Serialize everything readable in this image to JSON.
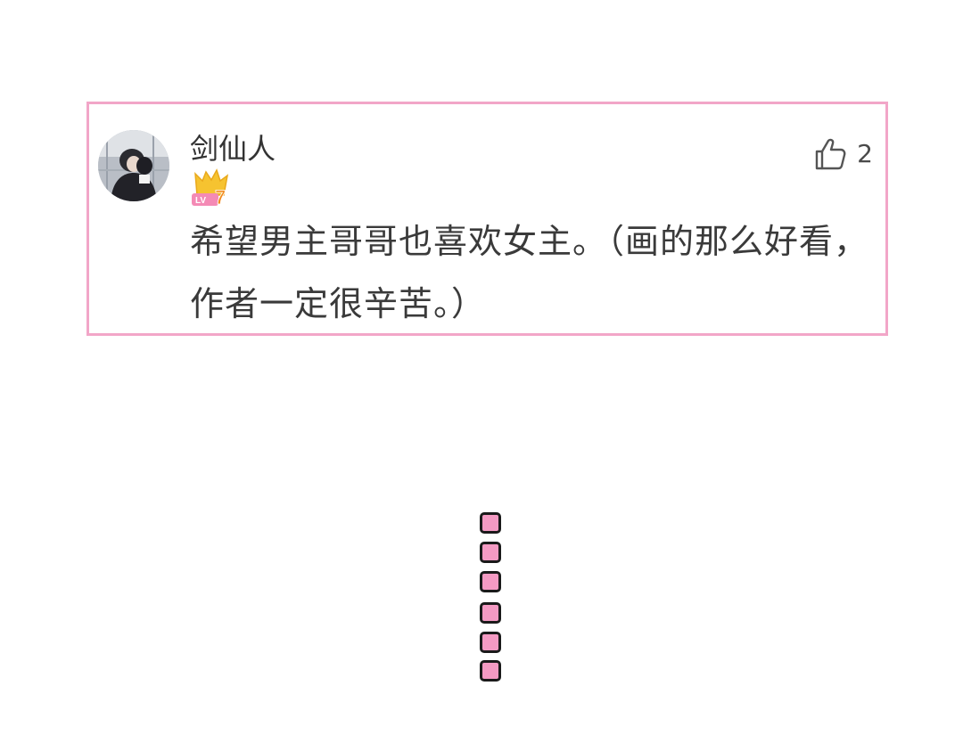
{
  "comment": {
    "username": "剑仙人",
    "level_badge": "LV7",
    "likes": "2",
    "text": "希望男主哥哥也喜欢女主。（画的那么好看，作者一定很辛苦。）"
  },
  "icons": {
    "like": "thumbs-up-icon",
    "avatar": "user-avatar",
    "divider": "vertical-dot-divider"
  },
  "colors": {
    "card_border": "#f2a6c8",
    "dot_fill": "#f49ac3",
    "badge_gold": "#f6c330",
    "badge_pink": "#f48ab5"
  }
}
